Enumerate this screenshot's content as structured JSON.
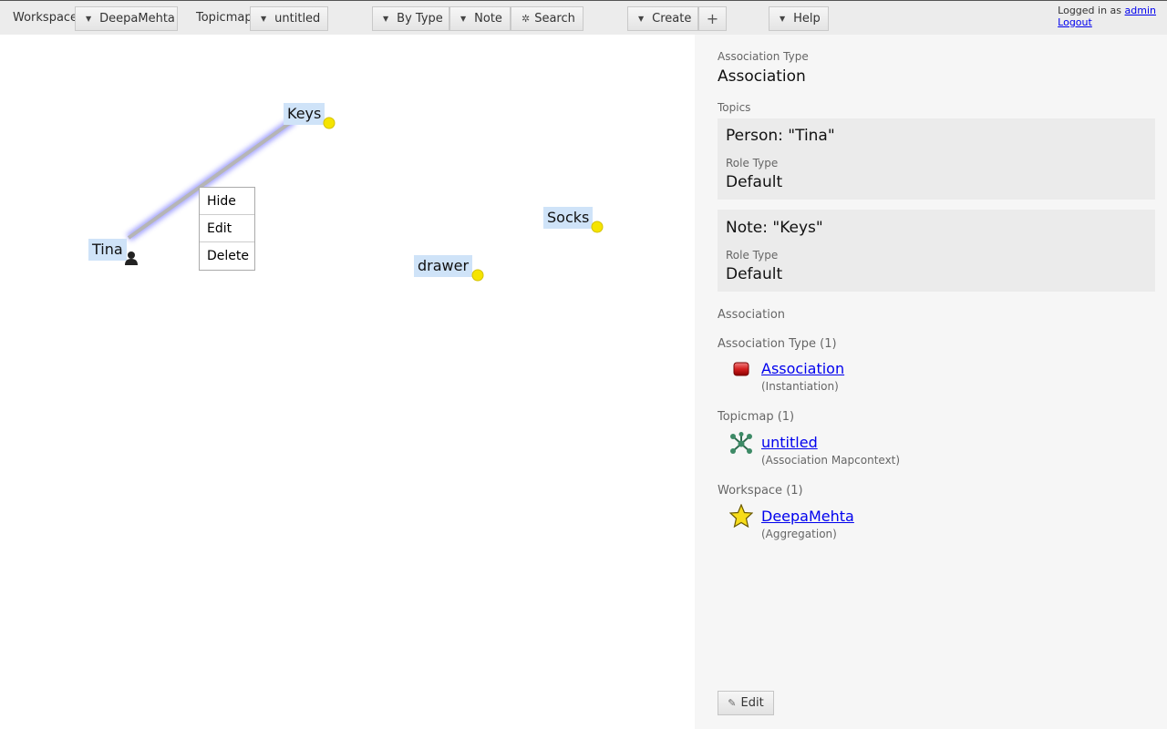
{
  "toolbar": {
    "workspace_label": "Workspace",
    "workspace_value": "DeepaMehta",
    "topicmap_label": "Topicmap",
    "topicmap_value": "untitled",
    "by_type": "By Type",
    "note": "Note",
    "search": "Search",
    "create": "Create",
    "add": "+",
    "help": "Help",
    "logged_in_text": "Logged in as",
    "user": "admin",
    "logout": "Logout"
  },
  "canvas": {
    "topics": [
      {
        "label": "Keys",
        "icon": "yellow-dot-icon"
      },
      {
        "label": "Tina",
        "icon": "person-icon"
      },
      {
        "label": "drawer",
        "icon": "yellow-dot-icon"
      },
      {
        "label": "Socks",
        "icon": "yellow-dot-icon"
      }
    ],
    "context_menu": [
      "Hide",
      "Edit",
      "Delete"
    ]
  },
  "panel": {
    "assoc_type_label": "Association Type",
    "assoc_type_value": "Association",
    "topics_label": "Topics",
    "topics": [
      {
        "title": "Person: \"Tina\"",
        "role_label": "Role Type",
        "role_value": "Default"
      },
      {
        "title": "Note: \"Keys\"",
        "role_label": "Role Type",
        "role_value": "Default"
      }
    ],
    "association_heading": "Association",
    "relations": [
      {
        "group": "Association Type (1)",
        "link": "Association",
        "sub": "(Instantiation)",
        "icon": "association-type-icon"
      },
      {
        "group": "Topicmap (1)",
        "link": "untitled",
        "sub": "(Association Mapcontext)",
        "icon": "topicmap-icon"
      },
      {
        "group": "Workspace (1)",
        "link": "DeepaMehta",
        "sub": "(Aggregation)",
        "icon": "star-icon"
      }
    ],
    "edit_label": "Edit"
  },
  "colors": {
    "topic_label_bg": "#cfe3f8",
    "note_icon": "#f5e400",
    "link": "#0000ee",
    "association_line": "#b5b5b5",
    "association_glow": "#8c8cff"
  }
}
